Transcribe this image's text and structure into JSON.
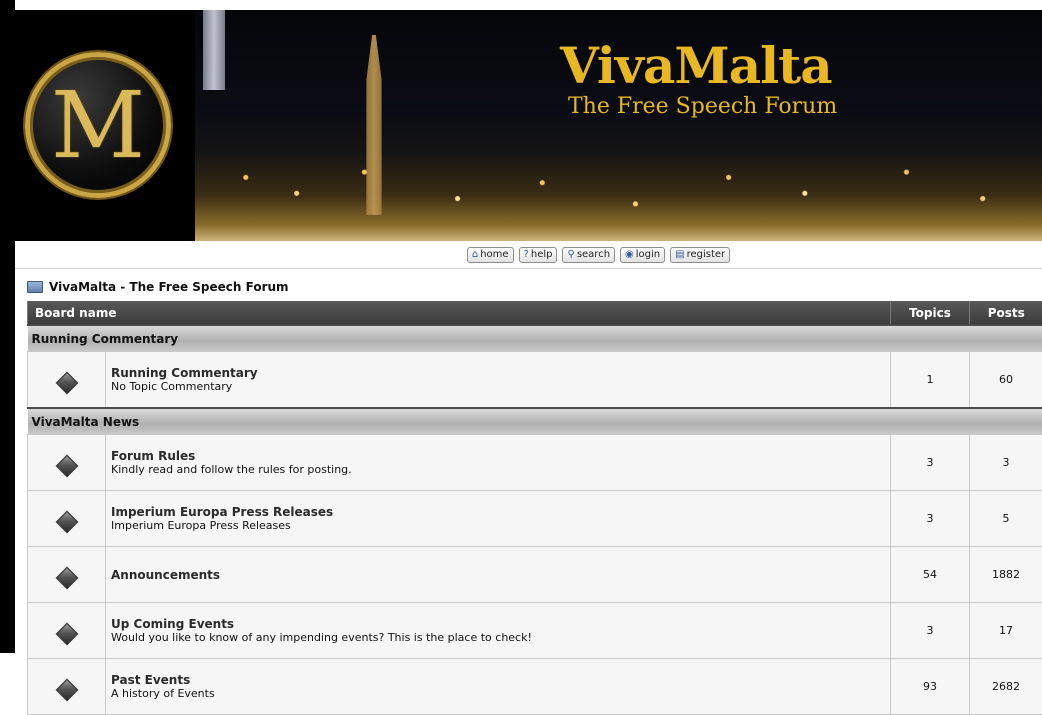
{
  "banner": {
    "title": "VivaMalta",
    "subtitle": "The Free Speech Forum",
    "logo_letters": "M"
  },
  "nav": [
    {
      "label": "home",
      "icon": "home-icon"
    },
    {
      "label": "help",
      "icon": "help-icon"
    },
    {
      "label": "search",
      "icon": "search-icon"
    },
    {
      "label": "login",
      "icon": "login-icon"
    },
    {
      "label": "register",
      "icon": "register-icon"
    }
  ],
  "breadcrumb": "VivaMalta - The Free Speech Forum",
  "table": {
    "headers": {
      "board": "Board name",
      "topics": "Topics",
      "posts": "Posts"
    },
    "categories": [
      {
        "name": "Running Commentary",
        "forums": [
          {
            "title": "Running Commentary",
            "desc": "No Topic Commentary",
            "topics": "1",
            "posts": "60"
          }
        ]
      },
      {
        "name": "VivaMalta News",
        "forums": [
          {
            "title": "Forum Rules",
            "desc": "Kindly read and follow the rules for posting.",
            "topics": "3",
            "posts": "3"
          },
          {
            "title": "Imperium Europa Press Releases",
            "desc": "Imperium Europa Press Releases",
            "topics": "3",
            "posts": "5"
          },
          {
            "title": "Announcements",
            "desc": "",
            "topics": "54",
            "posts": "1882"
          },
          {
            "title": "Up Coming Events",
            "desc": "Would you like to know of any impending events? This is the place to check!",
            "topics": "3",
            "posts": "17"
          },
          {
            "title": "Past Events",
            "desc": "A history of Events",
            "topics": "93",
            "posts": "2682"
          }
        ]
      }
    ]
  }
}
